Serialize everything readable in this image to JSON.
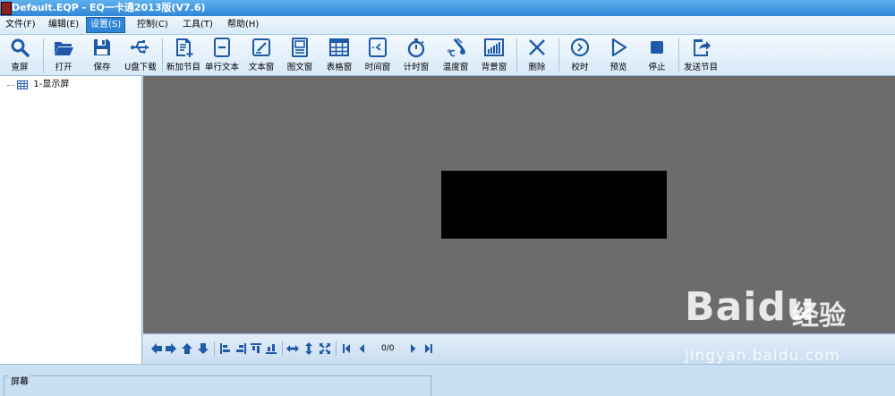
{
  "window": {
    "title": "Default.EQP - EQ一卡通2013版(V7.6)"
  },
  "menu": [
    {
      "label": "文件(F)",
      "active": false
    },
    {
      "label": "编辑(E)",
      "active": false
    },
    {
      "label": "设置(S)",
      "active": true
    },
    {
      "label": "控制(C)",
      "active": false
    },
    {
      "label": "工具(T)",
      "active": false
    },
    {
      "label": "帮助(H)",
      "active": false
    }
  ],
  "toolbar": [
    {
      "id": "search",
      "label": "查屏",
      "icon": "magnifier-icon"
    },
    {
      "id": "open",
      "label": "打开",
      "icon": "folder-open-icon"
    },
    {
      "id": "save",
      "label": "保存",
      "icon": "floppy-disk-icon"
    },
    {
      "id": "usb",
      "label": "U盘下载",
      "icon": "usb-icon"
    },
    {
      "id": "new-program",
      "label": "新加节目",
      "icon": "new-document-icon"
    },
    {
      "id": "single-line",
      "label": "单行文本",
      "icon": "single-line-text-icon"
    },
    {
      "id": "text-window",
      "label": "文本窗",
      "icon": "text-edit-icon"
    },
    {
      "id": "image-window",
      "label": "图文窗",
      "icon": "picture-text-icon"
    },
    {
      "id": "table-window",
      "label": "表格窗",
      "icon": "table-icon"
    },
    {
      "id": "time-window",
      "label": "时间窗",
      "icon": "clock-icon"
    },
    {
      "id": "timer-window",
      "label": "计时窗",
      "icon": "stopwatch-icon"
    },
    {
      "id": "temperature-window",
      "label": "温度窗",
      "icon": "thermometer-icon"
    },
    {
      "id": "background-window",
      "label": "背景窗",
      "icon": "background-chart-icon"
    },
    {
      "id": "delete",
      "label": "删除",
      "icon": "x-icon"
    },
    {
      "id": "calibrate",
      "label": "校时",
      "icon": "clock-sync-icon"
    },
    {
      "id": "preview",
      "label": "预览",
      "icon": "play-icon"
    },
    {
      "id": "stop",
      "label": "停止",
      "icon": "stop-icon"
    },
    {
      "id": "send-program",
      "label": "发送节目",
      "icon": "send-icon"
    }
  ],
  "tree": {
    "node": "1-显示屏"
  },
  "bottom_toolbar": {
    "icons": [
      "arrow-left-icon",
      "arrow-right-icon",
      "arrow-up-icon",
      "arrow-down-icon",
      "align-left-icon",
      "align-right-icon",
      "align-top-icon",
      "align-bottom-icon",
      "stretch-horizontal-icon",
      "stretch-vertical-icon",
      "fit-icon",
      "first-page-icon",
      "prev-page-icon",
      "next-page-icon",
      "last-page-icon"
    ],
    "page": "0/0"
  },
  "panel": {
    "group_title": "屏幕"
  },
  "watermark": {
    "brand": "Bai",
    "brand2": "du",
    "suffix": "经验",
    "url": "jingyan.baidu.com"
  },
  "colors": {
    "accent": "#2f86d6",
    "canvas": "#6c6c6c",
    "screen": "#000000",
    "icon": "#1e5aa8"
  }
}
